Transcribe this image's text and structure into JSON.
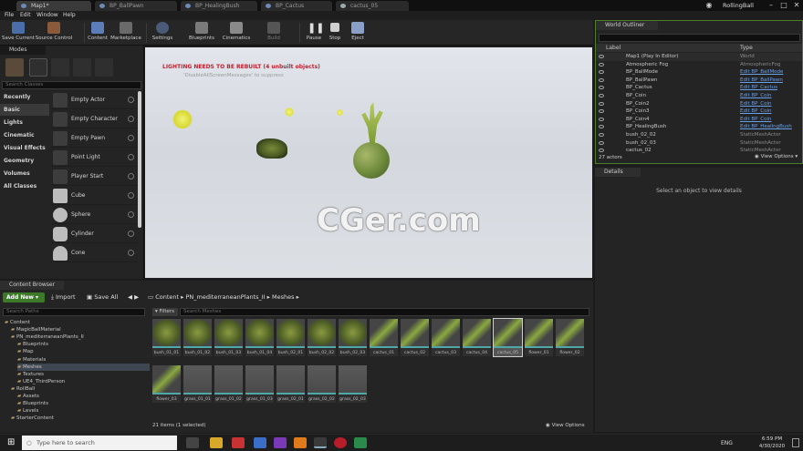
{
  "titlebar": {
    "tabs": [
      "Map1*",
      "BP_BallPawn",
      "BP_HealingBush",
      "BP_Cactus",
      "cactus_05"
    ],
    "project": "RollingBall"
  },
  "menu": [
    "File",
    "Edit",
    "Window",
    "Help"
  ],
  "toolbar": [
    "Save Current",
    "Source Control",
    "Content",
    "Marketplace",
    "Settings",
    "Blueprints",
    "Cinematics",
    "Build",
    "Pause",
    "Stop",
    "Eject"
  ],
  "modes": {
    "title": "Modes",
    "search_placeholder": "Search Classes",
    "categories": [
      "Recently Placed",
      "Basic",
      "Lights",
      "Cinematic",
      "Visual Effects",
      "Geometry",
      "Volumes",
      "All Classes"
    ],
    "selected_category": "Basic",
    "items": [
      "Empty Actor",
      "Empty Character",
      "Empty Pawn",
      "Point Light",
      "Player Start",
      "Cube",
      "Sphere",
      "Cylinder",
      "Cone"
    ]
  },
  "viewport": {
    "warning": "LIGHTING NEEDS TO BE REBUILT (4 unbuilt objects)",
    "suppress": "'DisableAllScreenMessages' to suppress",
    "watermark": "CGer.com"
  },
  "outliner": {
    "title": "World Outliner",
    "col_label": "Label",
    "col_type": "Type",
    "rows": [
      {
        "label": "Map1 (Play In Editor)",
        "type": "World",
        "link": false
      },
      {
        "label": "Atmospheric Fog",
        "type": "AtmosphericFog",
        "link": false
      },
      {
        "label": "BP_BallMode",
        "type": "Edit BP_BallMode",
        "link": true
      },
      {
        "label": "BP_BallPawn",
        "type": "Edit BP_BallPawn",
        "link": true
      },
      {
        "label": "BP_Cactus",
        "type": "Edit BP_Cactus",
        "link": true
      },
      {
        "label": "BP_Coin",
        "type": "Edit BP_Coin",
        "link": true
      },
      {
        "label": "BP_Coin2",
        "type": "Edit BP_Coin",
        "link": true
      },
      {
        "label": "BP_Coin3",
        "type": "Edit BP_Coin",
        "link": true
      },
      {
        "label": "BP_Coin4",
        "type": "Edit BP_Coin",
        "link": true
      },
      {
        "label": "BP_HealingBush",
        "type": "Edit BP_HealingBush",
        "link": true
      },
      {
        "label": "bush_02_02",
        "type": "StaticMeshActor",
        "link": false
      },
      {
        "label": "bush_02_03",
        "type": "StaticMeshActor",
        "link": false
      },
      {
        "label": "cactus_02",
        "type": "StaticMeshActor",
        "link": false
      }
    ],
    "count": "27 actors",
    "view_options": "View Options"
  },
  "details": {
    "title": "Details",
    "empty": "Select an object to view details"
  },
  "content_browser": {
    "title": "Content Browser",
    "add_new": "Add New",
    "import": "Import",
    "save_all": "Save All",
    "all": "All",
    "breadcrumb": [
      "Content",
      "PN_mediterraneanPlants_II",
      "Meshes"
    ],
    "search_paths": "Search Paths",
    "filters": "Filters",
    "search_meshes": "Search Meshes",
    "tree": [
      {
        "label": "Content",
        "depth": 0
      },
      {
        "label": "MagicBallMaterial",
        "depth": 1
      },
      {
        "label": "PN_mediterraneanPlants_II",
        "depth": 1
      },
      {
        "label": "Blueprints",
        "depth": 2
      },
      {
        "label": "Map",
        "depth": 2
      },
      {
        "label": "Materials",
        "depth": 2
      },
      {
        "label": "Meshes",
        "depth": 2
      },
      {
        "label": "Textures",
        "depth": 2
      },
      {
        "label": "UE4_ThirdPerson",
        "depth": 2
      },
      {
        "label": "RollBall",
        "depth": 1
      },
      {
        "label": "Assets",
        "depth": 2
      },
      {
        "label": "Blueprints",
        "depth": 2
      },
      {
        "label": "Levels",
        "depth": 2
      },
      {
        "label": "StarterContent",
        "depth": 1
      }
    ],
    "assets": [
      "bush_01_01",
      "bush_01_02",
      "bush_01_03",
      "bush_01_04",
      "bush_02_01",
      "bush_02_02",
      "bush_02_03",
      "cactus_01",
      "cactus_02",
      "cactus_03",
      "cactus_04",
      "cactus_05",
      "flower_01",
      "flower_02",
      "flower_03",
      "grass_01_01",
      "grass_01_02",
      "grass_01_03",
      "grass_02_01",
      "grass_02_02",
      "grass_02_03"
    ],
    "selected_asset": "cactus_05",
    "status": "21 items (1 selected)",
    "view_options": "View Options"
  },
  "taskbar": {
    "search": "Type here to search",
    "lang": "ENG",
    "time": "6:59 PM",
    "date": "4/30/2020"
  }
}
